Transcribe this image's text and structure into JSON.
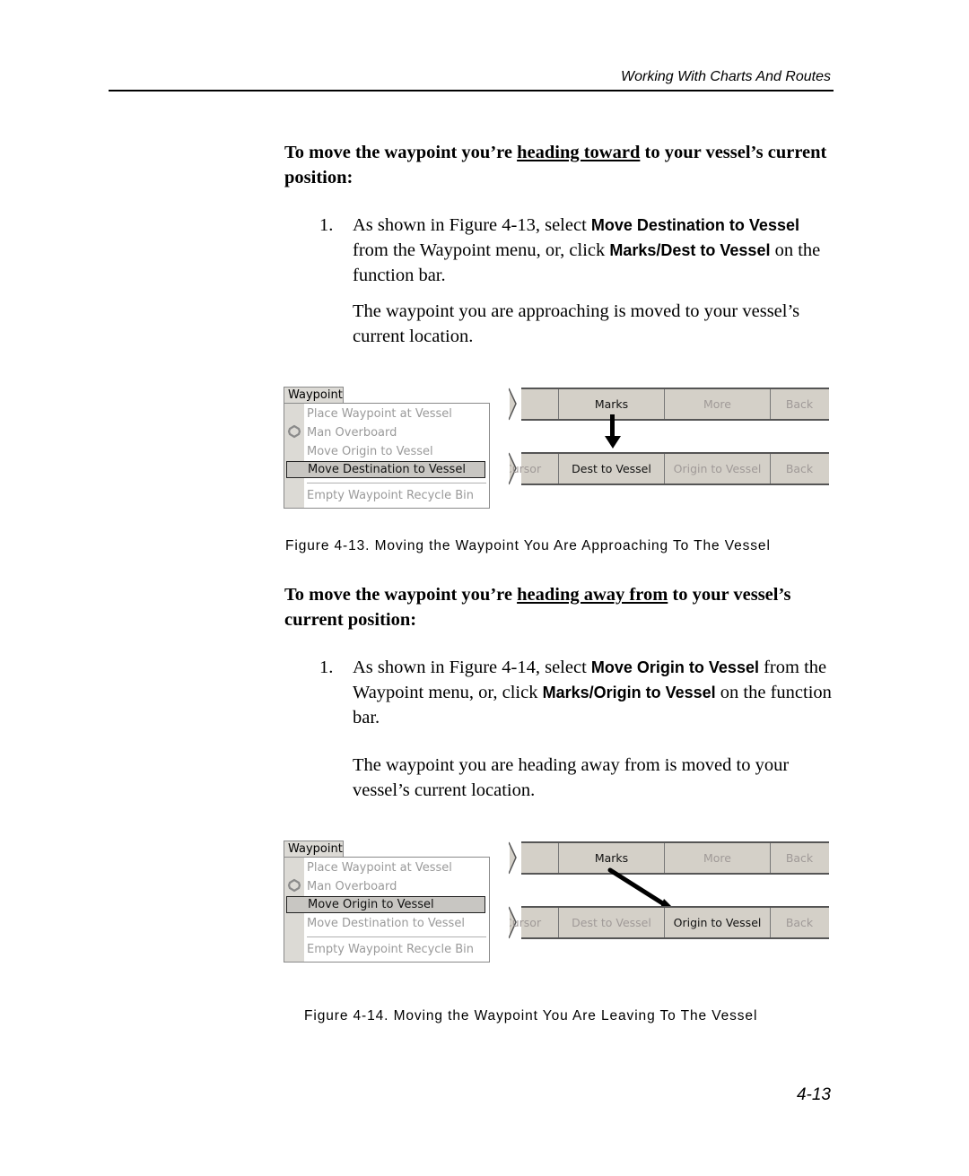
{
  "running_head": "Working With Charts And Routes",
  "page_number": "4-13",
  "section1": {
    "heading_pre": "To move the waypoint you’re ",
    "heading_underlined": "heading toward",
    "heading_post": " to your vessel’s current position:",
    "step_number": "1.",
    "step_text": {
      "a": "As shown in Figure 4-13, select ",
      "b": "Move Destination to Vessel",
      "c": " from the Waypoint menu, or, click ",
      "d": "Marks/Dest to Vessel",
      "e": " on the function bar."
    },
    "result_text": "The waypoint you are approaching is moved to your vessel’s current location.",
    "figure": {
      "menu": {
        "title": "Waypoint",
        "items": [
          {
            "label": "Place Waypoint at Vessel",
            "state": "disabled"
          },
          {
            "label": "Man Overboard",
            "state": "disabled",
            "icon": "man-overboard-icon"
          },
          {
            "label": "Move Origin to Vessel",
            "state": "disabled"
          },
          {
            "label": "Move Destination to Vessel",
            "state": "selected"
          },
          {
            "label": "Empty Waypoint Recycle Bin",
            "state": "disabled"
          }
        ]
      },
      "function_bar_top": [
        "",
        "Marks",
        "More",
        "Back"
      ],
      "function_bar_bottom": [
        "Cursor",
        "Dest to Vessel",
        "Origin to Vessel",
        "Back"
      ],
      "active_top": "Marks",
      "active_bottom": "Dest to Vessel",
      "caption": "Figure 4-13.  Moving the Waypoint You Are Approaching To The Vessel"
    }
  },
  "section2": {
    "heading_pre": "To move the waypoint you’re ",
    "heading_underlined": "heading away from",
    "heading_post": " to your vessel’s current position:",
    "step_number": "1.",
    "step_text": {
      "a": "As shown in Figure 4-14, select ",
      "b": "Move Origin to Vessel",
      "c": " from the Waypoint menu, or, click ",
      "d": "Marks/Origin to Vessel",
      "e": " on the function bar."
    },
    "result_text": "The waypoint you are heading away from is moved to your vessel’s current location.",
    "figure": {
      "menu": {
        "title": "Waypoint",
        "items": [
          {
            "label": "Place Waypoint at Vessel",
            "state": "disabled"
          },
          {
            "label": "Man Overboard",
            "state": "disabled",
            "icon": "man-overboard-icon"
          },
          {
            "label": "Move Origin to Vessel",
            "state": "selected"
          },
          {
            "label": "Move Destination to Vessel",
            "state": "disabled"
          },
          {
            "label": "Empty Waypoint Recycle Bin",
            "state": "disabled"
          }
        ]
      },
      "function_bar_top": [
        "",
        "Marks",
        "More",
        "Back"
      ],
      "function_bar_bottom": [
        "Cursor",
        "Dest to Vessel",
        "Origin to Vessel",
        "Back"
      ],
      "active_top": "Marks",
      "active_bottom": "Origin to Vessel",
      "caption": "Figure 4-14.  Moving the Waypoint You Are Leaving To The Vessel"
    }
  }
}
